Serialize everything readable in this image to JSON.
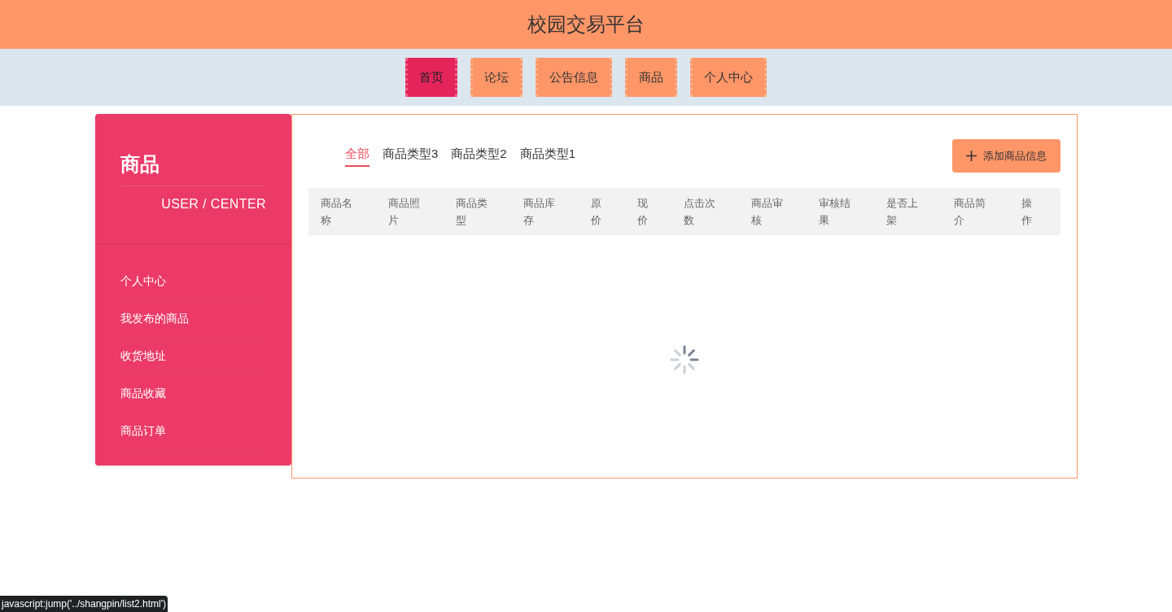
{
  "header": {
    "title": "校园交易平台"
  },
  "nav": [
    {
      "label": "首页",
      "selected": true
    },
    {
      "label": "论坛",
      "selected": false
    },
    {
      "label": "公告信息",
      "selected": false
    },
    {
      "label": "商品",
      "selected": false
    },
    {
      "label": "个人中心",
      "selected": false
    }
  ],
  "sidebar": {
    "title": "商品",
    "subtitle": "USER / CENTER",
    "items": [
      "个人中心",
      "我发布的商品",
      "收货地址",
      "商品收藏",
      "商品订单"
    ]
  },
  "filters": [
    {
      "label": "全部",
      "selected": true
    },
    {
      "label": "商品类型3",
      "selected": false
    },
    {
      "label": "商品类型2",
      "selected": false
    },
    {
      "label": "商品类型1",
      "selected": false
    }
  ],
  "add_button": {
    "label": "添加商品信息"
  },
  "table": {
    "columns": [
      "商品名称",
      "商品照片",
      "商品类型",
      "商品库存",
      "原价",
      "现价",
      "点击次数",
      "商品审核",
      "审核结果",
      "是否上架",
      "商品简介",
      "操作"
    ],
    "loading": true
  },
  "status_bar": {
    "text": "javascript:jump('../shangpin/list2.html')"
  }
}
